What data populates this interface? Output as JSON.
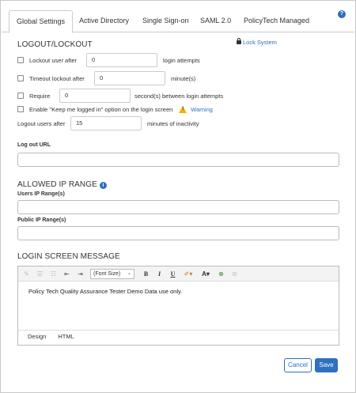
{
  "tabs": [
    {
      "label": "Global Settings",
      "active": true
    },
    {
      "label": "Active Directory",
      "active": false
    },
    {
      "label": "Single Sign-on",
      "active": false
    },
    {
      "label": "SAML 2.0",
      "active": false
    },
    {
      "label": "PolicyTech Managed",
      "active": false
    }
  ],
  "help_icon": "question-icon",
  "logout": {
    "title": "LOGOUT/LOCKOUT",
    "lock_system": "Lock System",
    "lockout_user": {
      "label": "Lockout user after",
      "value": "0",
      "suffix": "login attempts",
      "checked": false
    },
    "timeout_lockout": {
      "label": "Timeout lockout after",
      "value": "0",
      "suffix": "minute(s)",
      "checked": false
    },
    "require": {
      "label": "Require",
      "value": "0",
      "suffix": "second(s) between login attempts",
      "checked": false
    },
    "keep_logged_in": {
      "label": "Enable \"Keep me logged in\" option on the login screen",
      "warning": "Warning",
      "checked": false
    },
    "logout_after": {
      "label": "Logout users after",
      "value": "15",
      "suffix": "minutes of inactivity"
    }
  },
  "logout_url": {
    "label": "Log out URL",
    "value": ""
  },
  "ip_range": {
    "title": "ALLOWED IP RANGE",
    "users_label": "Users IP Range(s)",
    "users_value": "",
    "public_label": "Public IP Range(s)",
    "public_value": ""
  },
  "login_message": {
    "title": "LOGIN SCREEN MESSAGE",
    "font_size": "(Font Size)",
    "content": "Policy Tech Quality Assurance Tester Demo Data use only.",
    "tabs": [
      "Design",
      "HTML"
    ]
  },
  "buttons": {
    "cancel": "Cancel",
    "save": "Save"
  },
  "colors": {
    "accent": "#2e6fbf",
    "warning": "#f0b400"
  }
}
